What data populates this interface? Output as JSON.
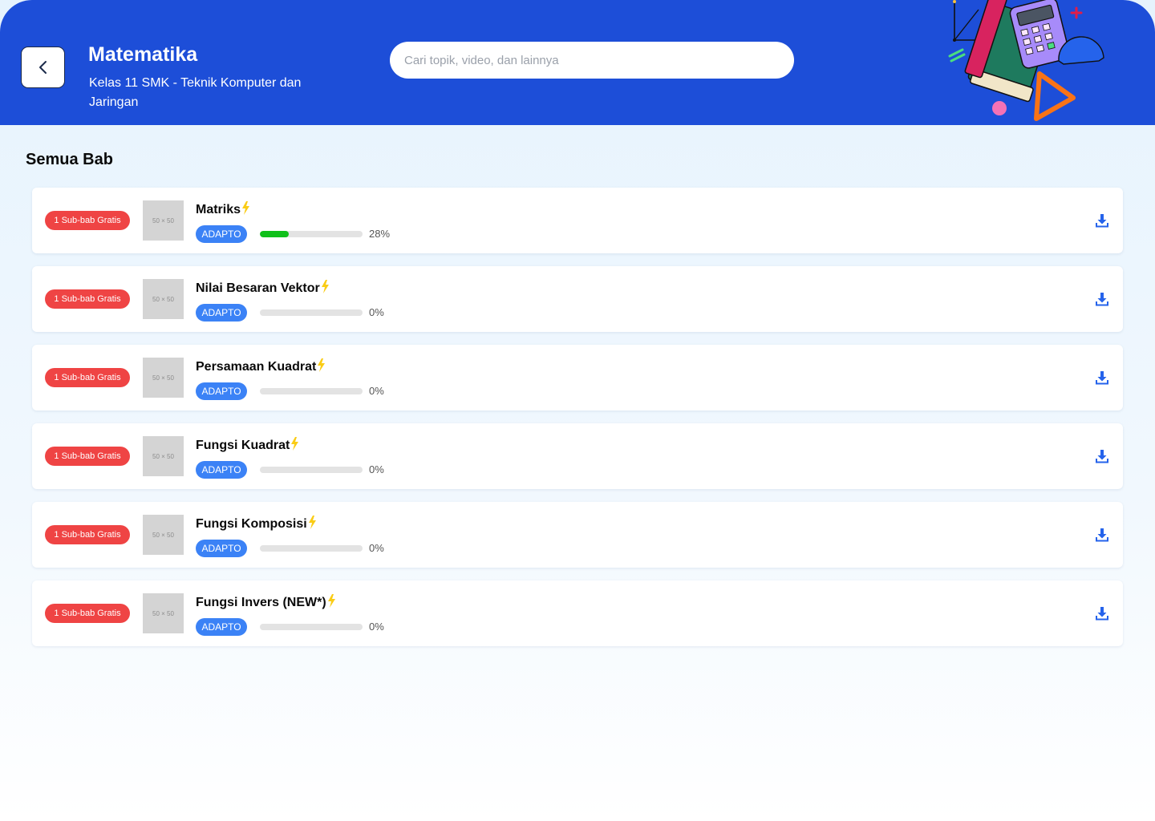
{
  "header": {
    "title": "Matematika",
    "subtitle": "Kelas 11 SMK - Teknik Komputer dan Jaringan",
    "back_icon": "chevron-left-icon",
    "search_placeholder": "Cari topik, video, dan lainnya"
  },
  "section": {
    "title": "Semua Bab"
  },
  "colors": {
    "header_bg": "#1d4ed8",
    "badge_free": "#ef4444",
    "badge_adapto": "#3b82f6",
    "progress_fill": "#10c01a",
    "bolt": "#facc15"
  },
  "chapters": [
    {
      "badge": "1 Sub-bab Gratis",
      "thumb": "50 × 50",
      "title": "Matriks",
      "tag": "ADAPTO",
      "progress": 28,
      "progress_label": "28%",
      "icon": "download-icon"
    },
    {
      "badge": "1 Sub-bab Gratis",
      "thumb": "50 × 50",
      "title": "Nilai Besaran Vektor",
      "tag": "ADAPTO",
      "progress": 0,
      "progress_label": "0%",
      "icon": "download-icon"
    },
    {
      "badge": "1 Sub-bab Gratis",
      "thumb": "50 × 50",
      "title": "Persamaan Kuadrat",
      "tag": "ADAPTO",
      "progress": 0,
      "progress_label": "0%",
      "icon": "download-icon"
    },
    {
      "badge": "1 Sub-bab Gratis",
      "thumb": "50 × 50",
      "title": "Fungsi Kuadrat",
      "tag": "ADAPTO",
      "progress": 0,
      "progress_label": "0%",
      "icon": "download-icon"
    },
    {
      "badge": "1 Sub-bab Gratis",
      "thumb": "50 × 50",
      "title": "Fungsi Komposisi",
      "tag": "ADAPTO",
      "progress": 0,
      "progress_label": "0%",
      "icon": "download-icon"
    },
    {
      "badge": "1 Sub-bab Gratis",
      "thumb": "50 × 50",
      "title": "Fungsi Invers (NEW*)",
      "tag": "ADAPTO",
      "progress": 0,
      "progress_label": "0%",
      "icon": "download-icon"
    }
  ]
}
